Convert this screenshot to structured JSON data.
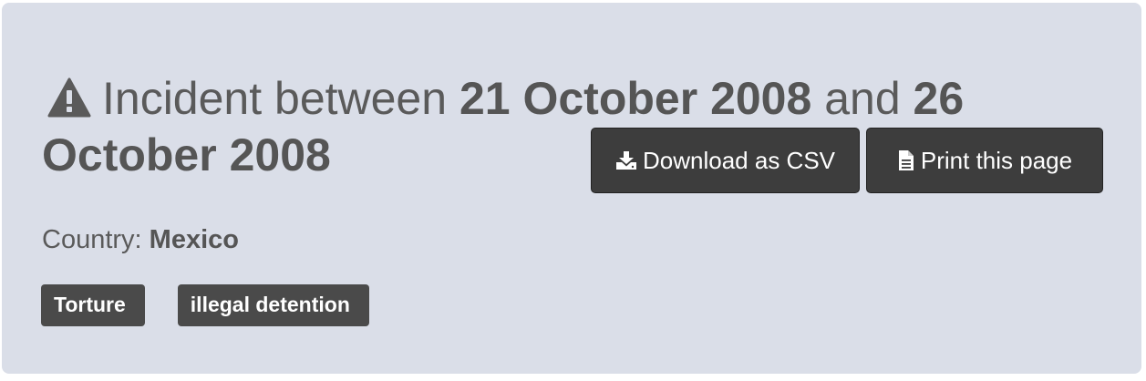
{
  "incident": {
    "prefix": "Incident between",
    "start_date": "21 October 2008",
    "connector": "and",
    "end_date": "26 October 2008",
    "icon": "warning-triangle-icon"
  },
  "actions": {
    "download_label": "Download as CSV",
    "download_icon": "download-icon",
    "print_label": "Print this page",
    "print_icon": "document-icon"
  },
  "country": {
    "label": "Country:",
    "value": "Mexico"
  },
  "tags": [
    "Torture",
    "illegal detention"
  ],
  "colors": {
    "panel_bg": "#dadee8",
    "button_bg": "#3d3d3d",
    "tag_bg": "#4a4a4a",
    "text": "#5a5a5a"
  }
}
